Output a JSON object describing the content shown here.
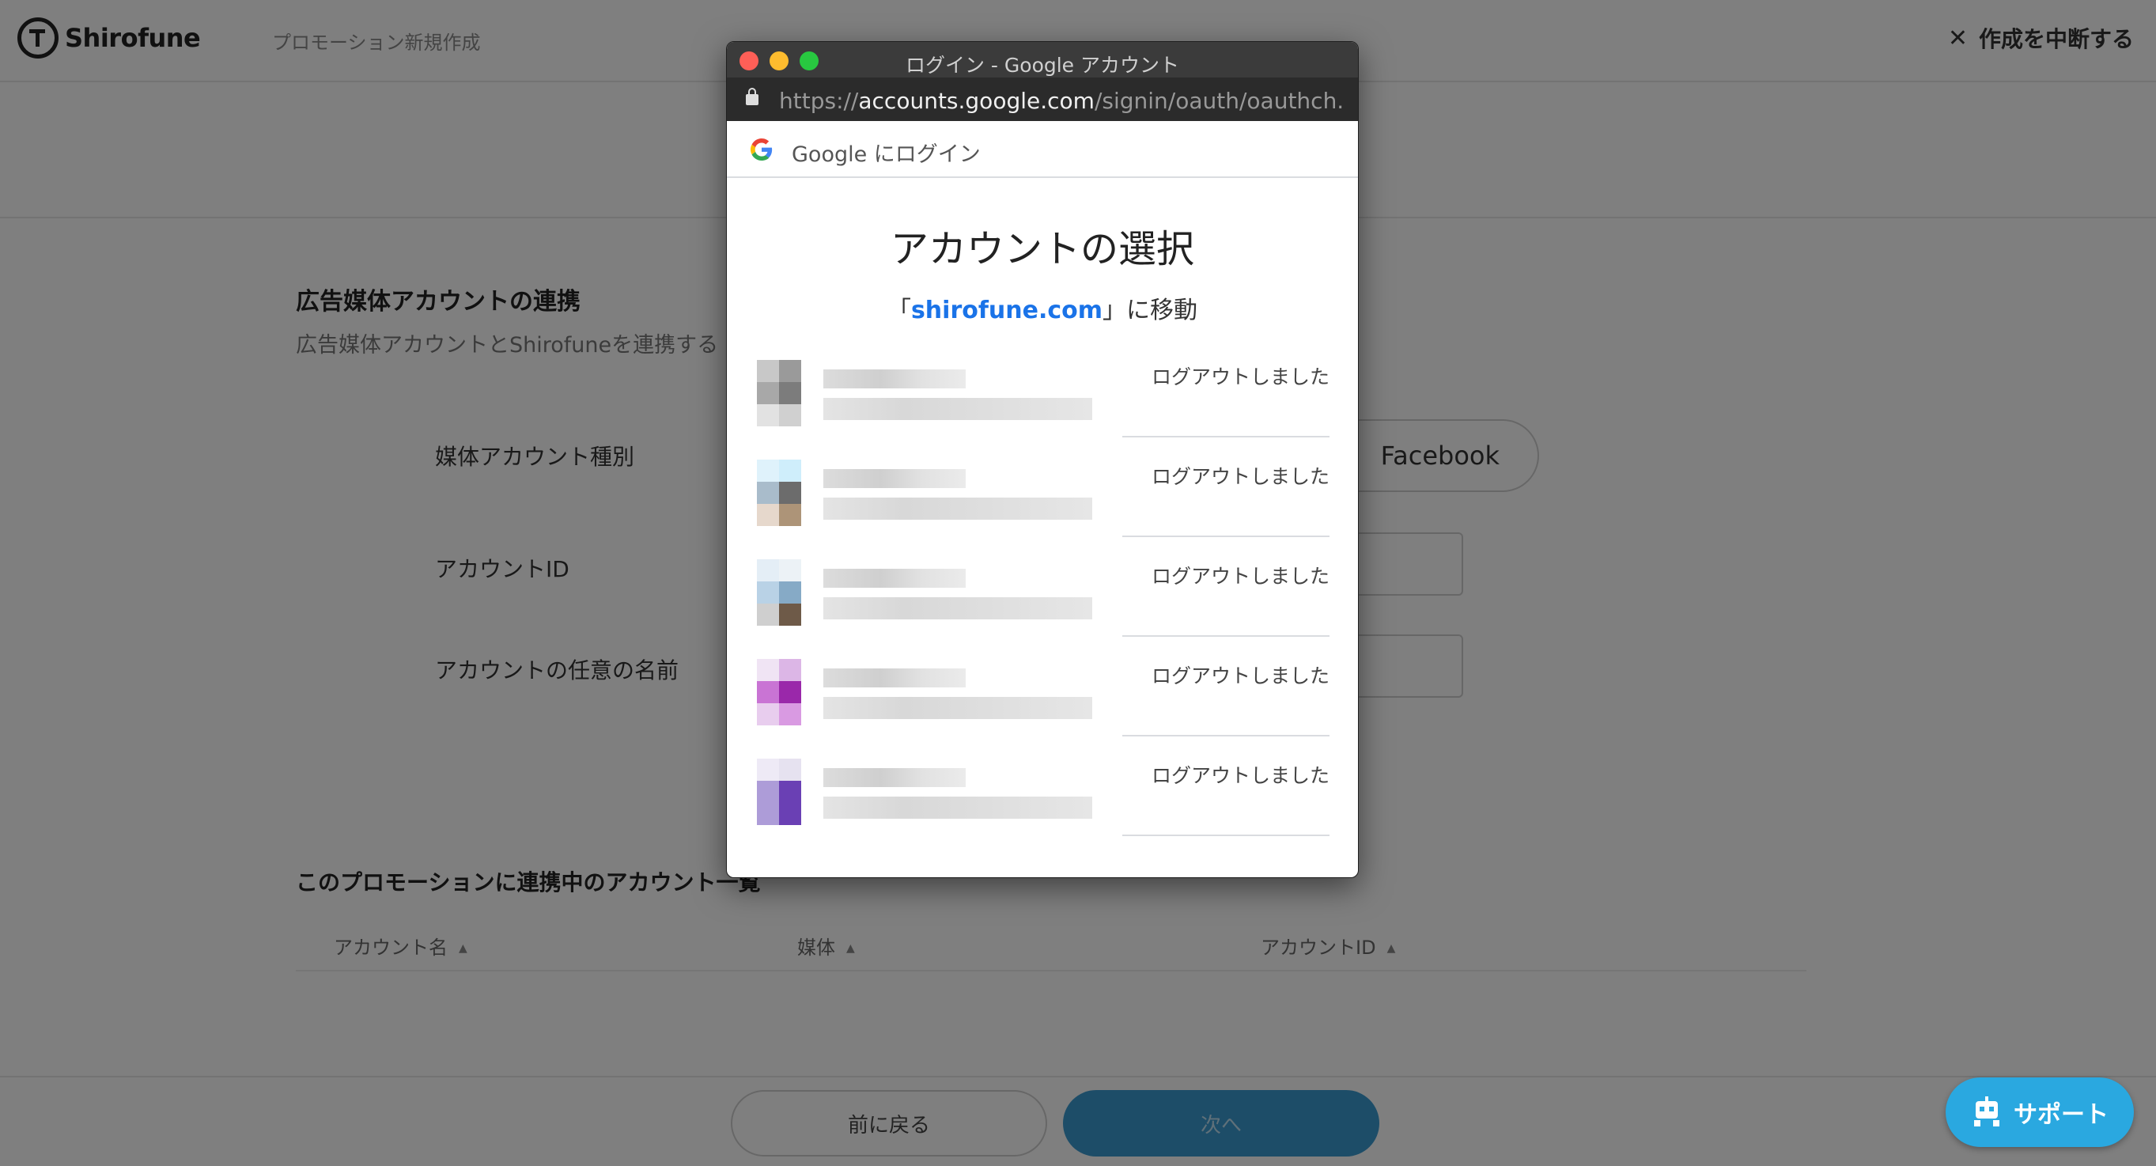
{
  "app": {
    "brand": "Shirofune",
    "breadcrumb": "プロモーション新規作成",
    "abort_label": "作成を中断する",
    "section_title": "広告媒体アカウントの連携",
    "section_desc": "広告媒体アカウントとShirofuneを連携する",
    "form": {
      "media_type_label": "媒体アカウント種別",
      "media_type_option": "Facebook",
      "account_id_label": "アカウントID",
      "account_name_label": "アカウントの任意の名前"
    },
    "linked_list": {
      "title": "このプロモーションに連携中のアカウント一覧",
      "columns": [
        "アカウント名",
        "媒体",
        "アカウントID"
      ]
    },
    "footer": {
      "back_label": "前に戻る",
      "next_label": "次へ"
    },
    "support_label": "サポート"
  },
  "popup": {
    "window_title": "ログイン - Google アカウント",
    "url_scheme": "https://",
    "url_host": "accounts.google.com",
    "url_path": "/signin/oauth/oauthch...",
    "google_bar_label": "Google にログイン",
    "heading": "アカウントの選択",
    "redirect_prefix": "「",
    "redirect_site": "shirofune.com",
    "redirect_suffix": "」に移動",
    "accounts": [
      {
        "status": "ログアウトしました",
        "avatar_colors": [
          "#c8c8c8",
          "#9a9a9a",
          "#a8a8a8",
          "#7c7c7c",
          "#e2e2e2",
          "#d0d0d0"
        ]
      },
      {
        "status": "ログアウトしました",
        "avatar_colors": [
          "#dff2fb",
          "#cfeefb",
          "#a9bccb",
          "#6c6c6c",
          "#e6d8cc",
          "#ad9478"
        ]
      },
      {
        "status": "ログアウトしました",
        "avatar_colors": [
          "#e4eef6",
          "#ecf2f6",
          "#b9d2e6",
          "#86aac6",
          "#cfcfcf",
          "#6e5a48"
        ]
      },
      {
        "status": "ログアウトしました",
        "avatar_colors": [
          "#f0e4f4",
          "#dcb6e6",
          "#c974d4",
          "#9a28aa",
          "#e8cdee",
          "#d99ae2"
        ]
      },
      {
        "status": "ログアウトしました",
        "avatar_colors": [
          "#eeeaf6",
          "#e6e2f0",
          "#ad9cd8",
          "#6a40b4",
          "#ad9cd8",
          "#6a40b4"
        ]
      }
    ]
  }
}
